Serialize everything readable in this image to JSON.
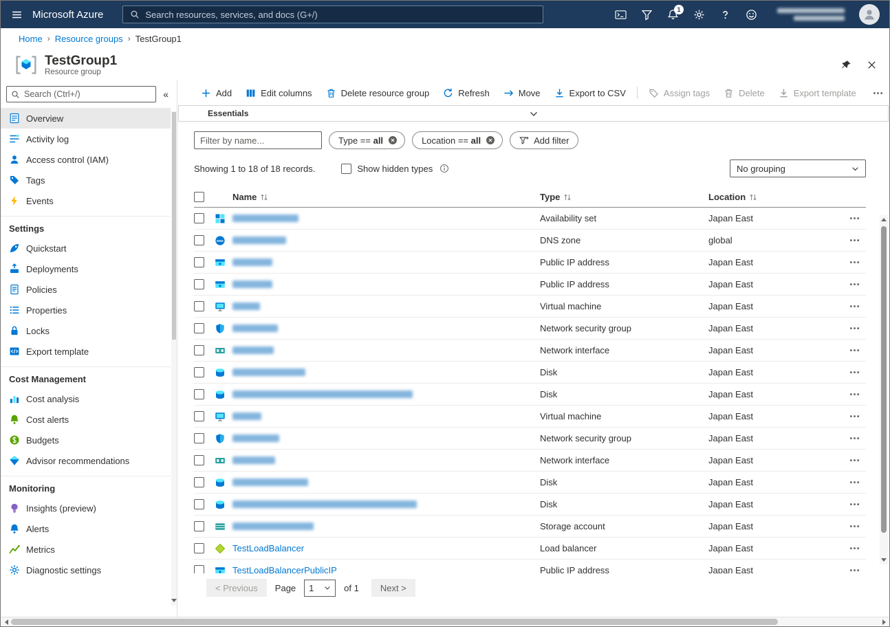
{
  "colors": {
    "accent": "#0078d4",
    "topbar_background": "#1e3a5c",
    "link": "#0078d4",
    "selected_nav_background": "#e9e9e9"
  },
  "topbar": {
    "brand": "Microsoft Azure",
    "search_placeholder": "Search resources, services, and docs (G+/)",
    "notification_count": "1"
  },
  "breadcrumb": {
    "home": "Home",
    "parent": "Resource groups",
    "current": "TestGroup1",
    "separator": "›"
  },
  "header": {
    "title": "TestGroup1",
    "subtitle": "Resource group"
  },
  "sidebar": {
    "search_placeholder": "Search (Ctrl+/)",
    "collapse_glyph": "«",
    "entries": [
      {
        "kind": "item",
        "label": "Overview",
        "icon": "overview",
        "selected": true
      },
      {
        "kind": "item",
        "label": "Activity log",
        "icon": "activity-log"
      },
      {
        "kind": "item",
        "label": "Access control (IAM)",
        "icon": "iam"
      },
      {
        "kind": "item",
        "label": "Tags",
        "icon": "tags"
      },
      {
        "kind": "item",
        "label": "Events",
        "icon": "events"
      },
      {
        "kind": "header",
        "label": "Settings"
      },
      {
        "kind": "item",
        "label": "Quickstart",
        "icon": "quickstart"
      },
      {
        "kind": "item",
        "label": "Deployments",
        "icon": "deployments"
      },
      {
        "kind": "item",
        "label": "Policies",
        "icon": "policies"
      },
      {
        "kind": "item",
        "label": "Properties",
        "icon": "properties"
      },
      {
        "kind": "item",
        "label": "Locks",
        "icon": "locks"
      },
      {
        "kind": "item",
        "label": "Export template",
        "icon": "export-template"
      },
      {
        "kind": "header",
        "label": "Cost Management"
      },
      {
        "kind": "item",
        "label": "Cost analysis",
        "icon": "cost-analysis"
      },
      {
        "kind": "item",
        "label": "Cost alerts",
        "icon": "cost-alerts"
      },
      {
        "kind": "item",
        "label": "Budgets",
        "icon": "budgets"
      },
      {
        "kind": "item",
        "label": "Advisor recommendations",
        "icon": "advisor"
      },
      {
        "kind": "header",
        "label": "Monitoring"
      },
      {
        "kind": "item",
        "label": "Insights (preview)",
        "icon": "insights"
      },
      {
        "kind": "item",
        "label": "Alerts",
        "icon": "alerts"
      },
      {
        "kind": "item",
        "label": "Metrics",
        "icon": "metrics"
      },
      {
        "kind": "item",
        "label": "Diagnostic settings",
        "icon": "diagnostics"
      }
    ]
  },
  "command_bar": {
    "items": [
      {
        "label": "Add",
        "icon": "plus"
      },
      {
        "label": "Edit columns",
        "icon": "columns"
      },
      {
        "label": "Delete resource group",
        "icon": "trash"
      },
      {
        "label": "Refresh",
        "icon": "refresh"
      },
      {
        "label": "Move",
        "icon": "move"
      },
      {
        "label": "Export to CSV",
        "icon": "download"
      },
      {
        "label": "Assign tags",
        "icon": "tag",
        "disabled": true,
        "divider_before": true
      },
      {
        "label": "Delete",
        "icon": "trash",
        "disabled": true
      },
      {
        "label": "Export template",
        "icon": "download",
        "disabled": true
      }
    ]
  },
  "essentials": {
    "label": "Essentials"
  },
  "filter_bar": {
    "name_placeholder": "Filter by name...",
    "pills": [
      {
        "prefix": "Type == ",
        "value": "all"
      },
      {
        "prefix": "Location == ",
        "value": "all"
      }
    ],
    "add_filter_label": "Add filter"
  },
  "records_bar": {
    "summary": "Showing 1 to 18 of 18 records.",
    "show_hidden_label": "Show hidden types",
    "grouping_value": "No grouping"
  },
  "table": {
    "columns": [
      "Name",
      "Type",
      "Location"
    ],
    "rows": [
      {
        "redacted": true,
        "name": "",
        "name_width": 96,
        "icon": "availability-set",
        "type": "Availability set",
        "location": "Japan East"
      },
      {
        "redacted": true,
        "name": "",
        "name_width": 78,
        "icon": "dns",
        "type": "DNS zone",
        "location": "global"
      },
      {
        "redacted": true,
        "name": "",
        "name_width": 58,
        "icon": "public-ip",
        "type": "Public IP address",
        "location": "Japan East"
      },
      {
        "redacted": true,
        "name": "",
        "name_width": 58,
        "icon": "public-ip",
        "type": "Public IP address",
        "location": "Japan East"
      },
      {
        "redacted": true,
        "name": "",
        "name_width": 40,
        "icon": "vm",
        "type": "Virtual machine",
        "location": "Japan East"
      },
      {
        "redacted": true,
        "name": "",
        "name_width": 66,
        "icon": "nsg",
        "type": "Network security group",
        "location": "Japan East"
      },
      {
        "redacted": true,
        "name": "",
        "name_width": 60,
        "icon": "nic",
        "type": "Network interface",
        "location": "Japan East"
      },
      {
        "redacted": true,
        "name": "",
        "name_width": 106,
        "icon": "disk",
        "type": "Disk",
        "location": "Japan East"
      },
      {
        "redacted": true,
        "name": "",
        "name_width": 262,
        "icon": "disk",
        "type": "Disk",
        "location": "Japan East"
      },
      {
        "redacted": true,
        "name": "",
        "name_width": 42,
        "icon": "vm",
        "type": "Virtual machine",
        "location": "Japan East"
      },
      {
        "redacted": true,
        "name": "",
        "name_width": 68,
        "icon": "nsg",
        "type": "Network security group",
        "location": "Japan East"
      },
      {
        "redacted": true,
        "name": "",
        "name_width": 62,
        "icon": "nic",
        "type": "Network interface",
        "location": "Japan East"
      },
      {
        "redacted": true,
        "name": "",
        "name_width": 110,
        "icon": "disk",
        "type": "Disk",
        "location": "Japan East"
      },
      {
        "redacted": true,
        "name": "",
        "name_width": 268,
        "icon": "disk",
        "type": "Disk",
        "location": "Japan East"
      },
      {
        "redacted": true,
        "name": "",
        "name_width": 118,
        "icon": "storage",
        "type": "Storage account",
        "location": "Japan East"
      },
      {
        "redacted": false,
        "name": "TestLoadBalancer",
        "icon": "load-balancer",
        "type": "Load balancer",
        "location": "Japan East"
      },
      {
        "redacted": false,
        "name": "TestLoadBalancerPublicIP",
        "icon": "public-ip",
        "type": "Public IP address",
        "location": "Japan East"
      }
    ]
  },
  "pagination": {
    "previous_label": "< Previous",
    "page_label": "Page",
    "page_value": "1",
    "of_label": "of 1",
    "next_label": "Next >"
  }
}
